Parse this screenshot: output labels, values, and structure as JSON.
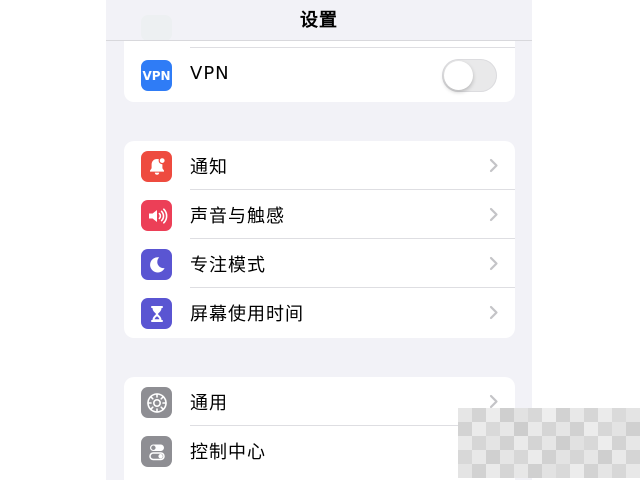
{
  "navbar": {
    "title": "设置"
  },
  "group_network": {
    "items": [
      {
        "label": "VPN",
        "icon": "vpn-icon",
        "icon_text": "VPN",
        "icon_color": "#2f7cf6",
        "toggle_on": false
      }
    ]
  },
  "group_alerts": {
    "items": [
      {
        "label": "通知",
        "icon": "notification-bell-icon",
        "icon_color": "#ee4b3f"
      },
      {
        "label": "声音与触感",
        "icon": "speaker-icon",
        "icon_color": "#ec3f57"
      },
      {
        "label": "专注模式",
        "icon": "moon-icon",
        "icon_color": "#5a55d2"
      },
      {
        "label": "屏幕使用时间",
        "icon": "hourglass-icon",
        "icon_color": "#5a55d2"
      }
    ]
  },
  "group_general": {
    "items": [
      {
        "label": "通用",
        "icon": "gear-icon",
        "icon_color": "#8e8e93"
      },
      {
        "label": "控制中心",
        "icon": "toggles-icon",
        "icon_color": "#8e8e93"
      }
    ]
  },
  "colors": {
    "background": "#f2f2f7",
    "chevron": "#c4c4c7",
    "previous_row_icon": "#65c466"
  }
}
